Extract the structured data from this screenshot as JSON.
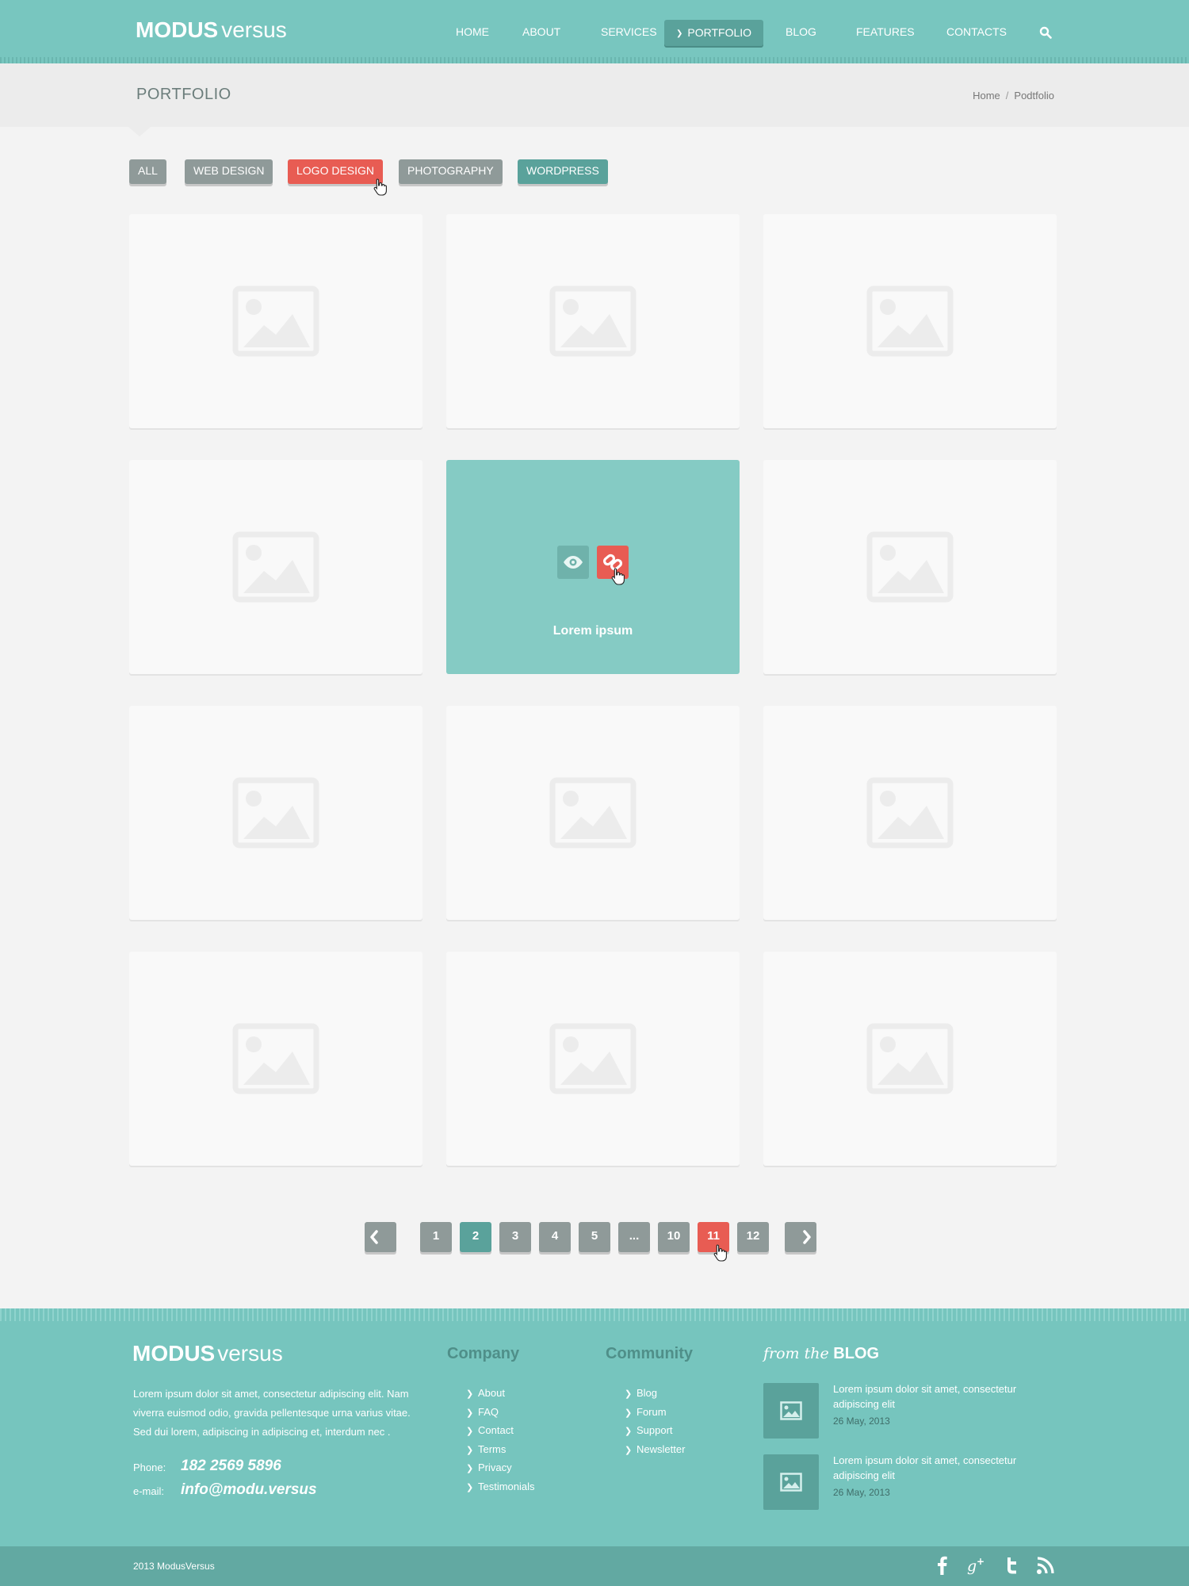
{
  "header": {
    "logo_bold": "MODUS",
    "logo_light": "versus",
    "nav": [
      "HOME",
      "ABOUT",
      "SERVICES",
      "PORTFOLIO",
      "BLOG",
      "FEATURES",
      "CONTACTS"
    ],
    "active_nav": "PORTFOLIO"
  },
  "titlebar": {
    "title": "PORTFOLIO",
    "breadcrumb": [
      "Home",
      "Podtfolio"
    ],
    "separator": "/"
  },
  "filters": {
    "items": [
      "ALL",
      "WEB DESIGN",
      "LOGO DESIGN",
      "PHOTOGRAPHY",
      "WORDPRESS"
    ]
  },
  "grid": {
    "hover_caption": "Lorem ipsum"
  },
  "pagination": {
    "pages": [
      "1",
      "2",
      "3",
      "4",
      "5",
      "...",
      "10",
      "11",
      "12"
    ],
    "current": "2",
    "hovered": "11"
  },
  "footer": {
    "logo_bold": "MODUS",
    "logo_light": "versus",
    "about": "Lorem ipsum dolor sit amet, consectetur adipiscing elit. Nam viverra euismod odio, gravida pellentesque urna varius vitae. Sed dui lorem, adipiscing in adipiscing et, interdum nec .",
    "phone_label": "Phone:",
    "phone": "182 2569 5896",
    "email_label": "e-mail:",
    "email": "info@modu.versus",
    "company_heading": "Company",
    "company_links": [
      "About",
      "FAQ",
      "Contact",
      "Terms",
      "Privacy",
      "Testimonials"
    ],
    "community_heading": "Community",
    "community_links": [
      "Blog",
      "Forum",
      "Support",
      "Newsletter"
    ],
    "blog_heading_italic": "from the",
    "blog_heading_bold": "BLOG",
    "posts": [
      {
        "title": "Lorem ipsum dolor sit amet, consectetur adipiscing elit",
        "date": "26 May, 2013"
      },
      {
        "title": "Lorem ipsum dolor sit amet, consectetur adipiscing elit",
        "date": "26 May, 2013"
      }
    ],
    "copyright": "2013  ModusVersus"
  },
  "colors": {
    "teal": "#78c6bf",
    "teal_dark": "#5aa29b",
    "red": "#e85c53",
    "gray_button": "#8f9a99"
  },
  "icons": [
    "search-icon",
    "image-placeholder-icon",
    "eye-icon",
    "link-icon",
    "chevron-left-icon",
    "chevron-right-icon",
    "facebook-icon",
    "google-plus-icon",
    "twitter-icon",
    "rss-icon",
    "hand-cursor-icon"
  ]
}
